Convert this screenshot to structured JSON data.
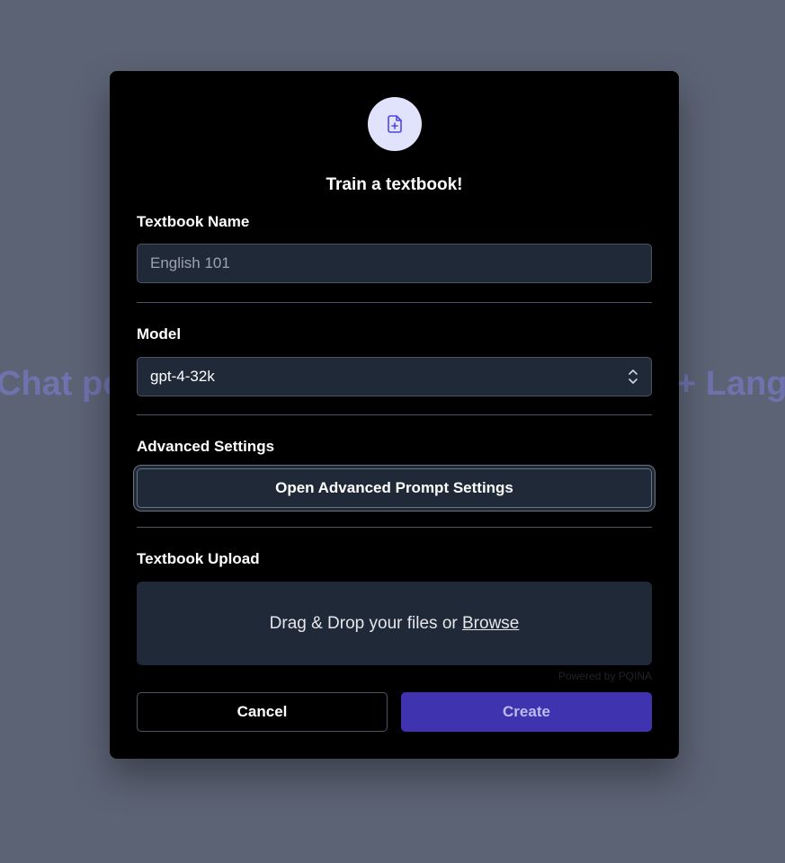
{
  "background": {
    "left_text": "Chat po",
    "right_text": "+ Lang"
  },
  "modal": {
    "icon": "file-plus-icon",
    "title": "Train a textbook!",
    "textbook_name": {
      "label": "Textbook Name",
      "placeholder": "English 101",
      "value": ""
    },
    "model": {
      "label": "Model",
      "selected": "gpt-4-32k"
    },
    "advanced": {
      "label": "Advanced Settings",
      "button_label": "Open Advanced Prompt Settings"
    },
    "upload": {
      "label": "Textbook Upload",
      "drop_text": "Drag & Drop your files or",
      "browse_text": "Browse",
      "powered_by": "Powered by PQINA"
    },
    "actions": {
      "cancel_label": "Cancel",
      "create_label": "Create"
    }
  },
  "colors": {
    "overlay": "#5c6374",
    "modal_bg": "#000000",
    "field_bg": "#1f2937",
    "accent": "#3f33b0",
    "icon_circle": "#e0e3fb",
    "icon_stroke": "#4f46e5"
  }
}
